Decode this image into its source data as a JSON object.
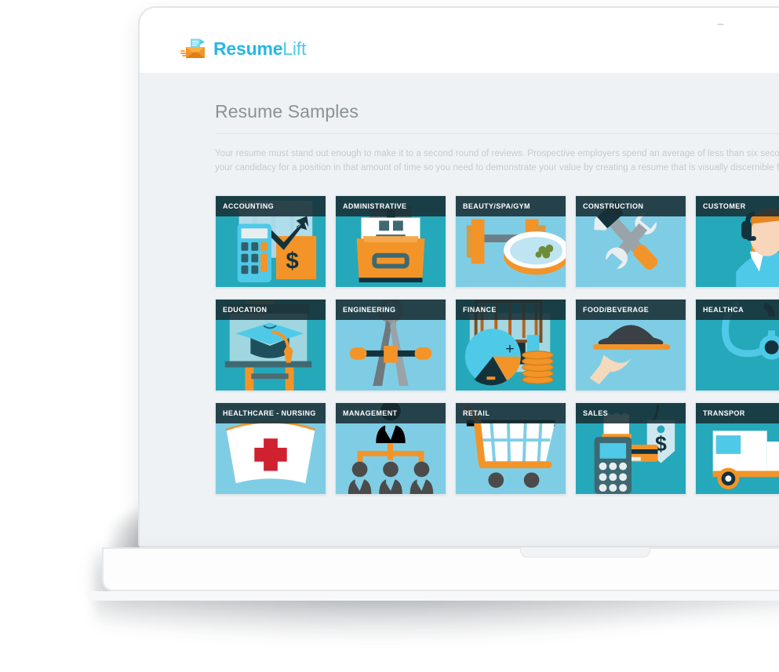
{
  "brand": {
    "name_bold": "Resume",
    "name_light": "Lift",
    "logo_icon": "envelope-document-icon"
  },
  "page": {
    "title": "Resume Samples",
    "intro_line1": "Your resume must stand out enough to make it to a second round of reviews. Prospective employers spend an average of less than six seconds looking at each r",
    "intro_line2": "your candidacy for a position in that amount of time so you need to demonstrate your value by creating a resume that is visually discernible from the rest."
  },
  "colors": {
    "brand_blue": "#27b6e3",
    "brand_blue_light": "#4fc9e8",
    "accent_orange": "#f39429",
    "card_bg_light": "#7fcde5",
    "card_bg_teal": "#25a8ba",
    "label_bg": "#192f36",
    "page_bg": "#eef2f5",
    "title_gray": "#8a9296",
    "body_gray": "#c3cbd1"
  },
  "cards": [
    {
      "label": "ACCOUNTING",
      "art": "calculator-chart-icon"
    },
    {
      "label": "ADMINISTRATIVE",
      "art": "file-drawer-icon"
    },
    {
      "label": "BEAUTY/SPA/GYM",
      "art": "dumbbell-spa-bowl-icon"
    },
    {
      "label": "CONSTRUCTION",
      "art": "hammer-wrench-icon"
    },
    {
      "label": "CUSTOMER",
      "art": "headset-agent-icon"
    },
    {
      "label": "EDUCATION",
      "art": "graduation-cap-board-icon"
    },
    {
      "label": "ENGINEERING",
      "art": "compass-divider-icon"
    },
    {
      "label": "FINANCE",
      "art": "pie-chart-coins-icon"
    },
    {
      "label": "FOOD/BEVERAGE",
      "art": "serving-tray-icon"
    },
    {
      "label": "HEALTHCA",
      "art": "stethoscope-icon"
    },
    {
      "label": "HEALTHCARE - NURSING",
      "art": "nurse-cap-icon"
    },
    {
      "label": "MANAGEMENT",
      "art": "org-chart-people-icon"
    },
    {
      "label": "RETAIL",
      "art": "shopping-cart-icon"
    },
    {
      "label": "SALES",
      "art": "card-terminal-pricetag-icon"
    },
    {
      "label": "TRANSPOR",
      "art": "delivery-truck-icon"
    }
  ]
}
